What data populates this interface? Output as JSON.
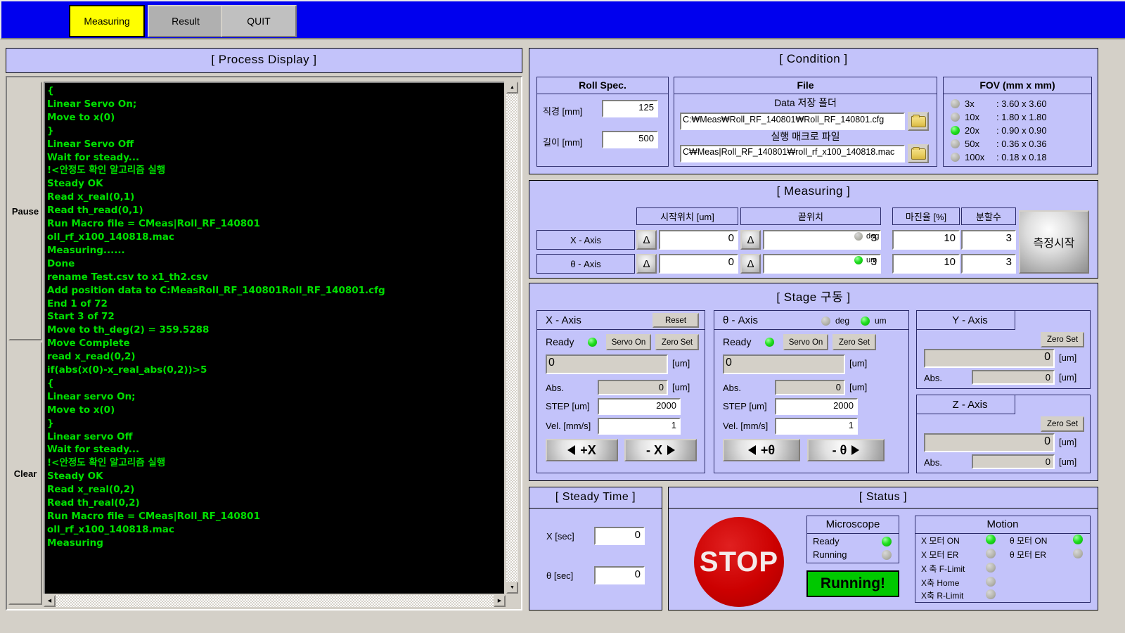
{
  "header": {
    "tabs": [
      {
        "label": "Measuring",
        "state": "active"
      },
      {
        "label": "Result",
        "state": "dim"
      },
      {
        "label": "QUIT",
        "state": "normal"
      }
    ]
  },
  "process_display": {
    "title": "[ Process Display ]",
    "pause_label": "Pause",
    "clear_label": "Clear",
    "log": "{\nLinear Servo On;\nMove to x(0)\n}\nLinear Servo Off\nWait for steady...\n!<안정도 확인 알고리즘 실행\nSteady OK\nRead x_real(0,1)\nRead th_read(0,1)\nRun Macro file = CMeas|Roll_RF_140801\noll_rf_x100_140818.mac\nMeasuring......\nDone\nrename Test.csv to x1_th2.csv\nAdd position data to C:MeasRoll_RF_140801Roll_RF_140801.cfg\nEnd 1 of 72\nStart 3 of 72\nMove to th_deg(2) = 359.5288\nMove Complete\nread x_read(0,2)\nif(abs(x(0)-x_real_abs(0,2))>5\n{\nLinear servo On;\nMove to x(0)\n}\nLinear servo Off\nWait for steady...\n!<안정도 확인 알고리즘 실행\nSteady OK\nRead x_real(0,2)\nRead th_real(0,2)\nRun Macro file = CMeas|Roll_RF_140801\noll_rf_x100_140818.mac\nMeasuring"
  },
  "condition": {
    "title": "[ Condition ]",
    "roll_spec": {
      "title": "Roll Spec.",
      "diameter_label": "직경  [mm]",
      "diameter_value": "125",
      "length_label": "길이  [mm]",
      "length_value": "500"
    },
    "file": {
      "title": "File",
      "data_folder_label": "Data 저장 폴더",
      "data_folder_value": "C:₩Meas₩Roll_RF_140801₩Roll_RF_140801.cfg",
      "macro_label": "실행 매크로 파일",
      "macro_value": "C₩Meas|Roll_RF_140801₩roll_rf_x100_140818.mac",
      "browse_icon": "folder-icon"
    },
    "fov": {
      "title": "FOV (mm x mm)",
      "rows": [
        {
          "mag": "3x",
          "value": ": 3.60 x 3.60",
          "on": false
        },
        {
          "mag": "10x",
          "value": ": 1.80 x 1.80",
          "on": false
        },
        {
          "mag": "20x",
          "value": ": 0.90 x 0.90",
          "on": true
        },
        {
          "mag": "50x",
          "value": ": 0.36 x 0.36",
          "on": false
        },
        {
          "mag": "100x",
          "value": ": 0.18 x 0.18",
          "on": false
        }
      ]
    }
  },
  "measuring": {
    "title": "[ Measuring ]",
    "col_start": "시작위치 [um]",
    "col_end": "끝위치",
    "col_margin": "마진율 [%]",
    "col_divisions": "분할수",
    "delta_label": "Δ",
    "unit_deg": "deg",
    "unit_um": "um",
    "start_button": "측정시작",
    "rows": [
      {
        "axis": "X - Axis",
        "start": "0",
        "end": "3",
        "margin": "10",
        "divisions": "3"
      },
      {
        "axis": "θ - Axis",
        "start": "0",
        "end": "3",
        "margin": "10",
        "divisions": "3"
      }
    ]
  },
  "stage": {
    "title": "[ Stage 구동 ]",
    "x_axis": {
      "caption": "X - Axis",
      "reset_label": "Reset",
      "ready_label": "Ready",
      "servo_label": "Servo On",
      "zero_label": "Zero Set",
      "position": "0",
      "unit": "[um]",
      "abs_label": "Abs.",
      "abs_value": "0",
      "step_label": "STEP [um]",
      "step_value": "2000",
      "vel_label": "Vel. [mm/s]",
      "vel_value": "1",
      "jog_plus": "+X",
      "jog_minus": "- X"
    },
    "theta_axis": {
      "caption": "θ - Axis",
      "unit_deg": "deg",
      "unit_um": "um",
      "ready_label": "Ready",
      "servo_label": "Servo On",
      "zero_label": "Zero Set",
      "position": "0",
      "unit": "[um]",
      "abs_label": "Abs.",
      "abs_value": "0",
      "step_label": "STEP [um]",
      "step_value": "2000",
      "vel_label": "Vel. [mm/s]",
      "vel_value": "1",
      "jog_plus": "+θ",
      "jog_minus": "- θ"
    },
    "y_axis": {
      "caption": "Y - Axis",
      "zero_label": "Zero Set",
      "position": "0",
      "unit": "[um]",
      "abs_label": "Abs.",
      "abs_value": "0"
    },
    "z_axis": {
      "caption": "Z - Axis",
      "zero_label": "Zero Set",
      "position": "0",
      "unit": "[um]",
      "abs_label": "Abs.",
      "abs_value": "0"
    }
  },
  "steady_time": {
    "title": "[ Steady Time ]",
    "x_label": "X [sec]",
    "x_value": "0",
    "theta_label": "θ [sec]",
    "theta_value": "0"
  },
  "status": {
    "title": "[ Status ]",
    "stop_label": "STOP",
    "microscope": {
      "title": "Microscope",
      "rows": [
        {
          "label": "Ready",
          "on": true
        },
        {
          "label": "Running",
          "on": false
        }
      ]
    },
    "running_banner": "Running!",
    "motion": {
      "title": "Motion",
      "left": [
        {
          "label": "X 모터 ON",
          "on": true
        },
        {
          "label": "X 모터 ER",
          "on": false
        },
        {
          "label": "X 축 F-Limit",
          "on": false
        },
        {
          "label": "X축 Home",
          "on": false
        },
        {
          "label": "X축 R-Limit",
          "on": false
        }
      ],
      "right": [
        {
          "label": "θ 모터 ON",
          "on": true
        },
        {
          "label": "θ 모터 ER",
          "on": false
        }
      ]
    }
  },
  "colors": {
    "panel_bg": "#c3c3fa",
    "header_bg": "#0000ee",
    "active_tab": "#ffff00",
    "led_on": "#22e022",
    "stop_red": "#cc0000",
    "running_green": "#00c800",
    "log_text": "#00e000"
  }
}
